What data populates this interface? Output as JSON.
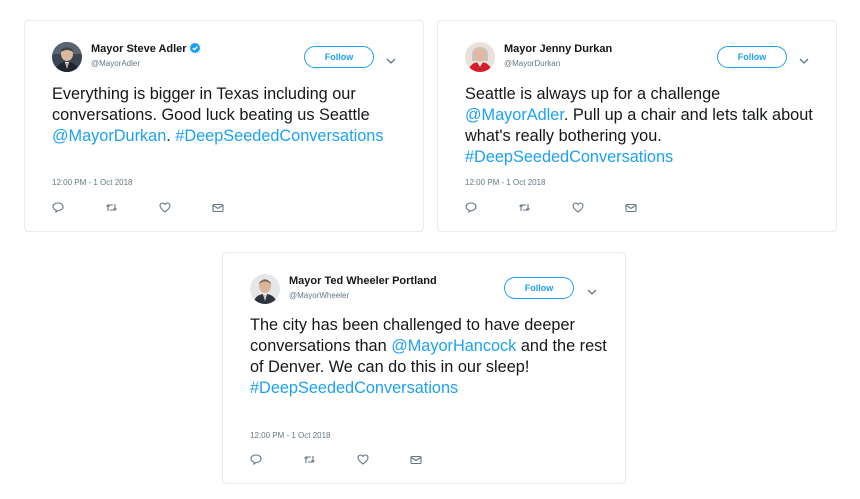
{
  "tweets": [
    {
      "name": "Mayor Steve Adler",
      "verified": true,
      "handle": "@MayorAdler",
      "follow_label": "Follow",
      "text": [
        {
          "t": "Everything is bigger in Texas including our conversations. Good luck beating us Seattle ",
          "link": false
        },
        {
          "t": "@MayorDurkan",
          "link": true
        },
        {
          "t": ". ",
          "link": false
        },
        {
          "t": "#DeepSeededConversations",
          "link": true
        }
      ],
      "timestamp": "12:00 PM - 1 Oct 2018",
      "avatar_icon": "profile-photo-adler"
    },
    {
      "name": "Mayor Jenny Durkan",
      "verified": false,
      "handle": "@MayorDurkan",
      "follow_label": "Follow",
      "text": [
        {
          "t": "Seattle is always up for a challenge ",
          "link": false
        },
        {
          "t": "@MayorAdler",
          "link": true
        },
        {
          "t": ". Pull up a chair and lets talk about what's really bothering you. ",
          "link": false
        },
        {
          "t": "#DeepSeededConversations",
          "link": true
        }
      ],
      "timestamp": "12:00 PM - 1 Oct 2018",
      "avatar_icon": "profile-photo-durkan"
    },
    {
      "name": "Mayor Ted Wheeler Portland",
      "verified": false,
      "handle": "@MayorWheeler",
      "follow_label": "Follow",
      "text": [
        {
          "t": "The city has been challenged to have deeper conversations than ",
          "link": false
        },
        {
          "t": "@MayorHancock",
          "link": true
        },
        {
          "t": " and the rest of Denver. We can do this in our sleep! ",
          "link": false
        },
        {
          "t": "#DeepSeededConversations",
          "link": true
        }
      ],
      "timestamp": "12:00 PM - 1 Oct 2018",
      "avatar_icon": "profile-photo-wheeler"
    }
  ],
  "action_icons": [
    "reply-icon",
    "retweet-icon",
    "like-icon",
    "message-icon"
  ],
  "colors": {
    "accent": "#1da1f2",
    "text": "#14171a",
    "muted": "#657786",
    "border": "#e6ecf0"
  }
}
